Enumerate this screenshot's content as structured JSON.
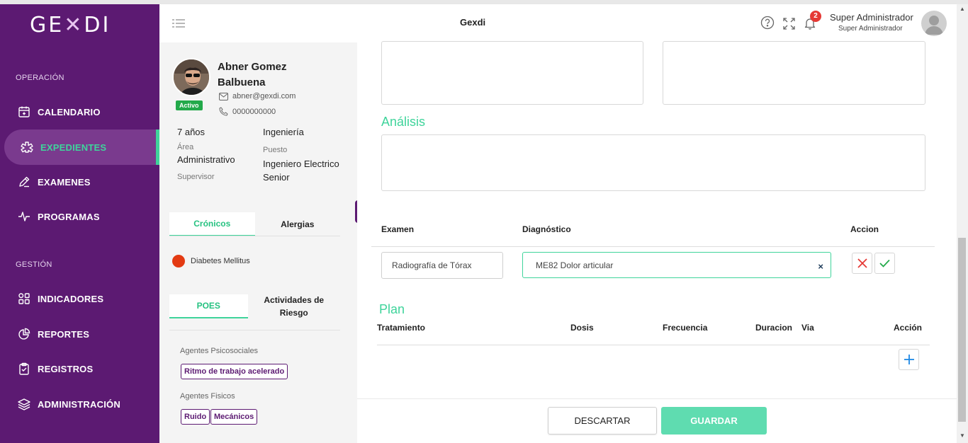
{
  "app": {
    "logo": "GEXDI",
    "title": "Gexdi"
  },
  "sidebar": {
    "sections": [
      {
        "label": "OPERACIÓN"
      },
      {
        "label": "GESTIÓN"
      }
    ],
    "items": [
      {
        "label": "CALENDARIO",
        "icon": "calendar-icon"
      },
      {
        "label": "EXPEDIENTES",
        "icon": "medical-cross-icon",
        "active": true
      },
      {
        "label": "EXAMENES",
        "icon": "pencil-icon"
      },
      {
        "label": "PROGRAMAS",
        "icon": "pulse-icon"
      },
      {
        "label": "INDICADORES",
        "icon": "grid-icon"
      },
      {
        "label": "REPORTES",
        "icon": "pie-chart-icon"
      },
      {
        "label": "REGISTROS",
        "icon": "clipboard-icon"
      },
      {
        "label": "ADMINISTRACIÓN",
        "icon": "layers-icon"
      }
    ]
  },
  "header": {
    "notifications_count": "2",
    "user_name": "Super Administrador",
    "user_role": "Super Administrador"
  },
  "profile": {
    "name": "Abner Gomez Balbuena",
    "status": "Activo",
    "email": "abner@gexdi.com",
    "phone": "0000000000",
    "seniority_value": "7 años",
    "department_value": "Ingeniería",
    "area_label": "Área",
    "area_value": "Administrativo",
    "position_label": "Puesto",
    "position_value": "Ingeniero Electrico Senior",
    "supervisor_label": "Supervisor",
    "tabs1": [
      "Crónicos",
      "Alergias"
    ],
    "chronic_item": "Diabetes Mellitus",
    "tabs2": [
      "POES",
      "Actividades de Riesgo"
    ],
    "psychosocial_label": "Agentes Psicosociales",
    "psychosocial_chips": [
      "Ritmo de trabajo acelerado"
    ],
    "physical_label": "Agentes Fisicos",
    "physical_chips": [
      "Ruido",
      "Mecánicos"
    ]
  },
  "main": {
    "analysis_title": "Análisis",
    "exam_table": {
      "headers": [
        "Examen",
        "Diagnóstico",
        "Accion"
      ],
      "exam_value": "Radiografía de Tórax",
      "diagnosis_value": "ME82 Dolor articular",
      "clear_symbol": "×"
    },
    "plan": {
      "title": "Plan",
      "headers": [
        "Tratamiento",
        "Dosis",
        "Frecuencia",
        "Duracion",
        "Via",
        "Acción"
      ]
    },
    "buttons": {
      "discard": "DESCARTAR",
      "save": "GUARDAR"
    }
  },
  "colors": {
    "sidebar": "#5c1a72",
    "accent": "#3fd49b",
    "save": "#5fdcb0",
    "danger": "#e53935",
    "link": "#1e88e5"
  }
}
